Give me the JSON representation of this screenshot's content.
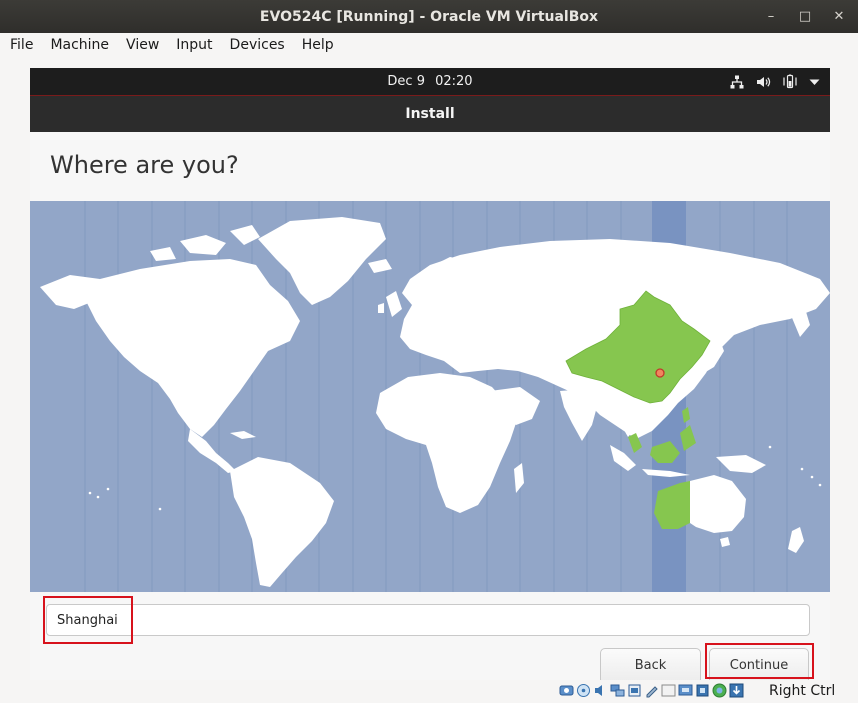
{
  "host": {
    "title": "EVO524C [Running] - Oracle VM VirtualBox",
    "window_controls": {
      "minimize": "–",
      "maximize": "□",
      "close": "✕"
    },
    "menu": [
      "File",
      "Machine",
      "View",
      "Input",
      "Devices",
      "Help"
    ],
    "status_icons": [
      "hard-disk-icon",
      "optical-drive-icon",
      "audio-icon",
      "network-icon",
      "usb-icon",
      "shared-folder-icon",
      "display-icon",
      "video-capture-icon",
      "cpu-icon",
      "mouse-integration-icon",
      "keyboard-capture-icon"
    ],
    "host_key": "Right Ctrl"
  },
  "guest": {
    "topbar": {
      "date": "Dec 9",
      "time": "02:20",
      "tray_icons": [
        "network-wired-icon",
        "volume-icon",
        "battery-icon",
        "system-menu-arrow-icon"
      ]
    },
    "installer": {
      "header": "Install",
      "page_title": "Where are you?",
      "location_value": "Shanghai",
      "buttons": {
        "back": "Back",
        "continue": "Continue"
      }
    },
    "map": {
      "selected_timezone_color": "#86c64f",
      "ocean_color": "#92a6c8",
      "band_color": "#7993c1"
    }
  }
}
